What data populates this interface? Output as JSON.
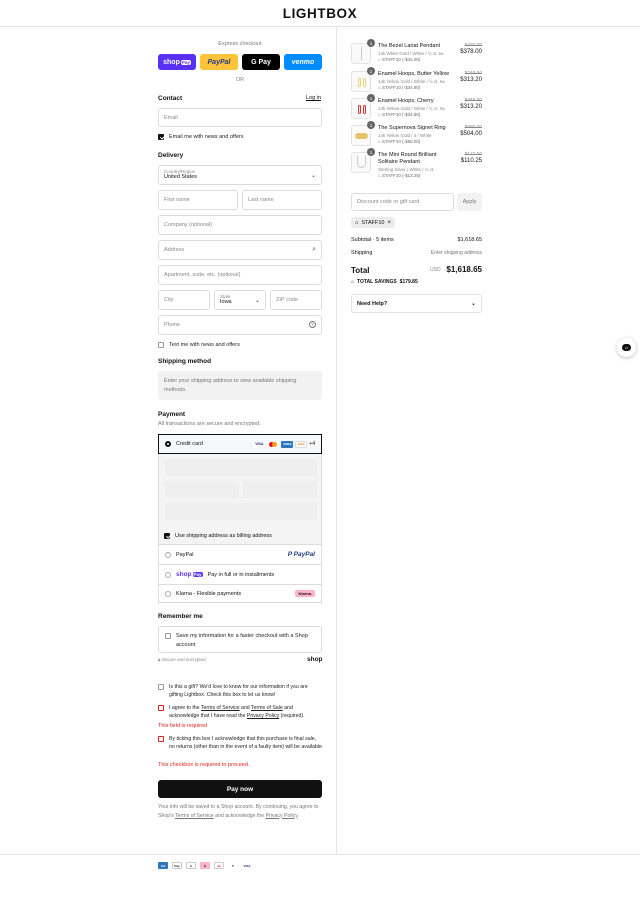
{
  "brand": "LIGHTBOX",
  "express": {
    "title": "Express checkout",
    "shop_pay": "shop",
    "shop_pay_badge": "Pay",
    "paypal": "PayPal",
    "gpay": "G Pay",
    "venmo": "venmo",
    "or": "OR"
  },
  "contact": {
    "heading": "Contact",
    "login": "Log in",
    "email_placeholder": "Email",
    "news_label": "Email me with news and offers"
  },
  "delivery": {
    "heading": "Delivery",
    "country_label": "Country/Region",
    "country_value": "United States",
    "first_name": "First name",
    "last_name": "Last name",
    "company": "Company (optional)",
    "address": "Address",
    "apartment": "Apartment, suite, etc. (optional)",
    "city": "City",
    "state_label": "State",
    "state_value": "Iowa",
    "zip": "ZIP code",
    "phone": "Phone",
    "text_news": "Text me with news and offers"
  },
  "shipping_method": {
    "heading": "Shipping method",
    "message": "Enter your shipping address to view available shipping methods."
  },
  "payment": {
    "heading": "Payment",
    "subtitle": "All transactions are secure and encrypted.",
    "credit_card": "Credit card",
    "more_cards": "+4",
    "billing_same": "Use shipping address as billing address",
    "paypal": "PayPal",
    "shoppay_text": "Pay in full or in installments",
    "klarna": "Klarna - Flexible payments",
    "klarna_badge": "Klarna."
  },
  "remember": {
    "heading": "Remember me",
    "save_info": "Save my information for a faster checkout with a Shop account",
    "secure": "Secure and encrypted",
    "shop_logo": "shop"
  },
  "consents": {
    "gift": "Is this a gift? We'd love to know for our information if you are gifting Lightbox. Check this box to let us know!",
    "terms_pre": "I agree to the ",
    "terms_link": "Terms of Service",
    "terms_and": " and ",
    "sale_link": "Terms of Sale",
    "terms_mid": " and acknowledge that I have read the ",
    "privacy_link": "Privacy Policy",
    "terms_post": " (required).",
    "field_required": "This field is required",
    "final_sale": "By ticking this box I acknowledge that this purchase is final sale, no returns (other than in the event of a faulty item) will be available",
    "checkbox_required": "This checkbox is required to proceed."
  },
  "pay_now": "Pay now",
  "footer_note": {
    "pre": "Your info will be saved to a Shop account. By continuing, you agree to Shop's ",
    "tos": "Terms of Service",
    "mid": " and acknowledge the ",
    "privacy": "Privacy Policy",
    "post": "."
  },
  "items": [
    {
      "qty": "1",
      "name": "The Bezel Lariat Pendant",
      "variant": "14k White Gold / White / ½ ct. tw.",
      "discount": "STAFF10 (-$42.00)",
      "old_price": "$420.00",
      "price": "$378.00"
    },
    {
      "qty": "1",
      "name": "Enamel Hoops, Butter Yellow",
      "variant": "14k Yellow Gold / White / ½ ct. tw.",
      "discount": "STAFF10 (-$34.80)",
      "old_price": "$348.00",
      "price": "$313.20"
    },
    {
      "qty": "1",
      "name": "Enamel Hoops, Cherry",
      "variant": "14k Yellow Gold / White / ½ ct. tw.",
      "discount": "STAFF10 (-$34.80)",
      "old_price": "$348.00",
      "price": "$313.20"
    },
    {
      "qty": "1",
      "name": "The Supernova Signet Ring",
      "variant": "14k Yellow Gold / 4 / White",
      "discount": "STAFF10 (-$56.00)",
      "old_price": "$560.00",
      "price": "$504.00"
    },
    {
      "qty": "1",
      "name": "The Mini Round Brilliant Solitaire Pendant",
      "variant": "Sterling Silver / White / ½ ct.",
      "discount": "STAFF10 (-$12.25)",
      "old_price": "$122.50",
      "price": "$110.25"
    }
  ],
  "discount_placeholder": "Discount code or gift card",
  "apply": "Apply",
  "applied_code": "STAFF10",
  "summary": {
    "subtotal_label": "Subtotal · 5 items",
    "subtotal": "$1,618.65",
    "shipping_label": "Shipping",
    "shipping": "Enter shipping address",
    "total_label": "Total",
    "currency": "USD",
    "total": "$1,618.65",
    "savings_label": "TOTAL SAVINGS",
    "savings": "$179.85"
  },
  "need_help": "Need Help?",
  "footer_icons": [
    "amex-icon",
    "applepay-icon",
    "gpay-icon",
    "klarna-icon",
    "mastercard-icon",
    "paypal-icon",
    "visa-icon"
  ],
  "colors": {
    "paypal_yellow": "#ffc439",
    "shop_purple": "#5a31f4",
    "venmo_blue": "#008cff",
    "error_red": "#d22222"
  }
}
